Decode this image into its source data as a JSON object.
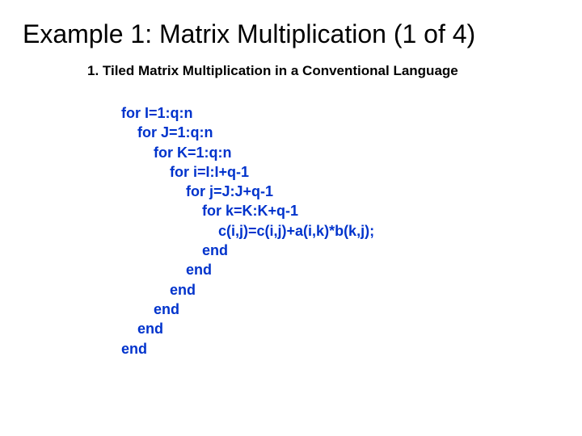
{
  "title": "Example 1: Matrix Multiplication (1 of 4)",
  "subtitle": "1. Tiled Matrix Multiplication in a Conventional Language",
  "code": {
    "l1": "for I=1:q:n",
    "l2": "    for J=1:q:n",
    "l3": "        for K=1:q:n",
    "l4": "            for i=I:I+q-1",
    "l5": "                for j=J:J+q-1",
    "l6": "                    for k=K:K+q-1",
    "l7": "                        c(i,j)=c(i,j)+a(i,k)*b(k,j);",
    "l8": "                    end",
    "l9": "                end",
    "l10": "            end",
    "l11": "        end",
    "l12": "    end",
    "l13": "end"
  }
}
